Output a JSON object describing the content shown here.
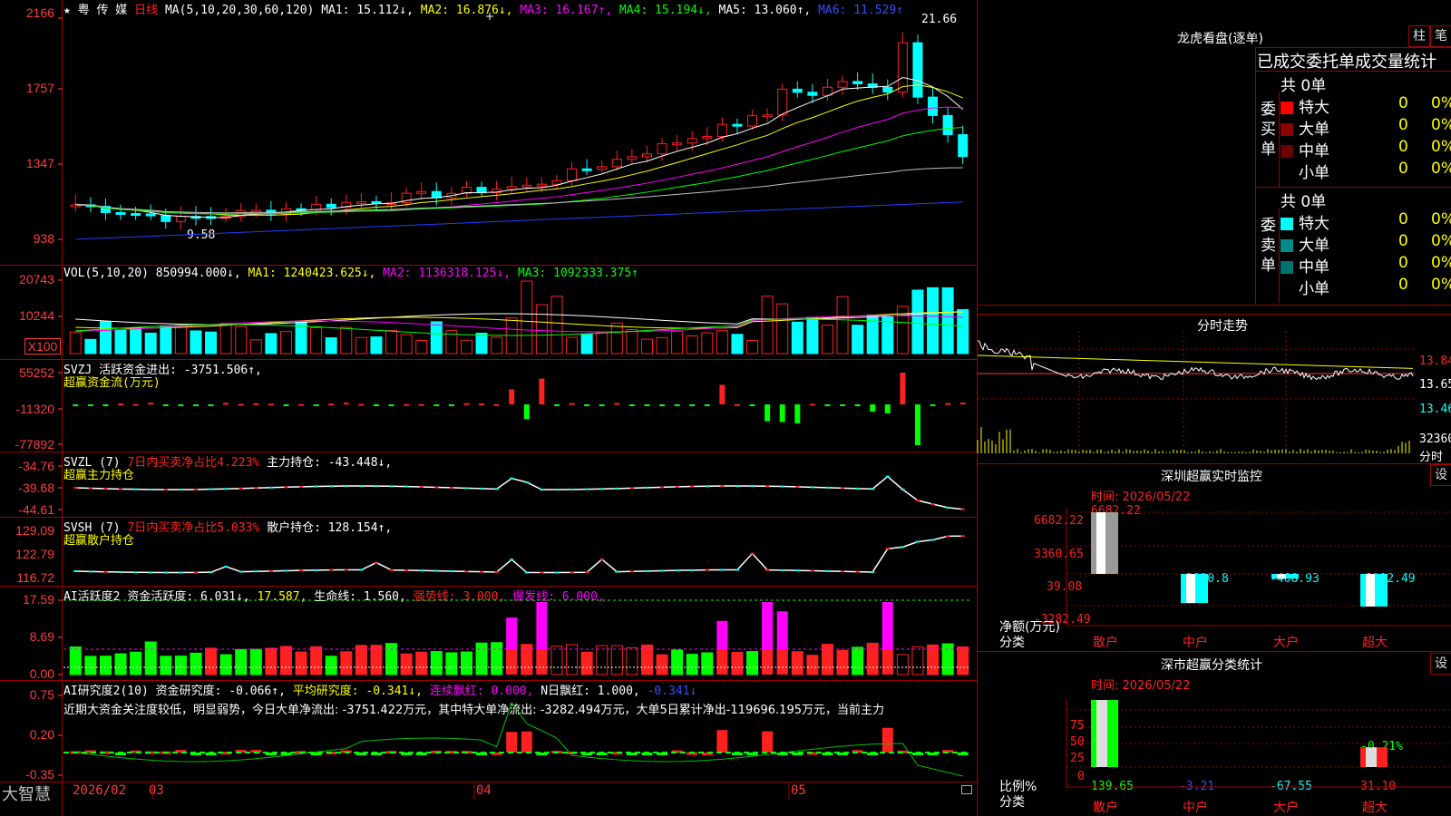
{
  "header": {
    "star": "★",
    "stock_name": "粤 传 媒",
    "period": "日线",
    "ma_params": "MA(5,10,20,30,60,120)",
    "ma1": "MA1: 15.112↓,",
    "ma2": "MA2: 16.876↓,",
    "ma3": "MA3: 16.167↑,",
    "ma4": "MA4: 15.194↓,",
    "ma5": "MA5: 13.060↑,",
    "ma6": "MA6: 11.529↑",
    "high_label": "21.66",
    "low_label": "9.58"
  },
  "price_axis": [
    "2166",
    "1757",
    "1347",
    "938"
  ],
  "vol": {
    "title": "VOL(5,10,20)",
    "value": "850994.000↓,",
    "ma1": "MA1: 1240423.625↓,",
    "ma2": "MA2: 1136318.125↓,",
    "ma3": "MA3: 1092333.375↑",
    "axis": [
      "20743",
      "10244"
    ],
    "unit": "X100"
  },
  "svzj": {
    "title": "SVZJ",
    "text": "活跃资金进出: -3751.506↑,",
    "subtitle": "超赢资金流(万元)",
    "axis": [
      "55252",
      "-11320",
      "-77892"
    ]
  },
  "svzl": {
    "title": "SVZL  (7)",
    "text1": "7日内买卖净占比4.223%",
    "text2": "主力持仓: -43.448↓,",
    "subtitle": "超赢主力持仓",
    "axis": [
      "-34.76",
      "-39.68",
      "-44.61"
    ]
  },
  "svsh": {
    "title": "SVSH  (7)",
    "text1": "7日内买卖净占比5.033%",
    "text2": "散户持仓: 128.154↑,",
    "subtitle": "超赢散户持仓",
    "axis": [
      "129.09",
      "122.79",
      "116.72"
    ]
  },
  "ai_active": {
    "title": "AI活跃度2",
    "text1": "资金活跃度: 6.031↓,",
    "text2": "17.587,",
    "text3": "生命线: 1.560,",
    "text4": "强势线: 3.000,",
    "text5": "爆发线: 6.000,",
    "axis": [
      "17.59",
      "8.69",
      "0.00"
    ]
  },
  "ai_research": {
    "title": "AI研究度2(10)",
    "text1": "资金研究度: -0.066↑,",
    "text2": "平均研究度: -0.341↓,",
    "text3": "连续飘红: 0.000,",
    "text4": "N日飘红: 1.000,",
    "text5": "-0.341↓",
    "comment": "近期大资金关注度较低，明显弱势，今日大单净流出: -3751.422万元，其中特大单净流出: -3282.494万元，大单5日累计净出-119696.195万元，当前主力",
    "axis": [
      "0.75",
      "0.20",
      "-0.35"
    ]
  },
  "date_axis": [
    "2026/02",
    "03",
    "04",
    "05"
  ],
  "brand": "大智慧",
  "lhb": {
    "title": "龙虎看盘(逐单)",
    "btn1": "柱",
    "btn2": "笔",
    "header": "已成交委托单成交量统计",
    "buy_label": "委买单",
    "sell_label": "委卖单",
    "buy_total": "共 0单",
    "sell_total": "共 0单",
    "buy_rows": [
      {
        "name": "特大",
        "count": "0",
        "pct": "0%",
        "color": "#ff0000"
      },
      {
        "name": "大单",
        "count": "0",
        "pct": "0%",
        "color": "#8b0000"
      },
      {
        "name": "中单",
        "count": "0",
        "pct": "0%",
        "color": "#6a0000"
      },
      {
        "name": "小单",
        "count": "0",
        "pct": "0%",
        "color": "#000000"
      }
    ],
    "sell_rows": [
      {
        "name": "特大",
        "count": "0",
        "pct": "0%",
        "color": "#00ffff"
      },
      {
        "name": "大单",
        "count": "0",
        "pct": "0%",
        "color": "#008b8b"
      },
      {
        "name": "中单",
        "count": "0",
        "pct": "0%",
        "color": "#007070"
      },
      {
        "name": "小单",
        "count": "0",
        "pct": "0%",
        "color": "#000000"
      }
    ]
  },
  "intraday": {
    "title": "分时走势",
    "axis": [
      "13.84",
      "13.65",
      "13.46"
    ],
    "vol_axis": [
      "32360",
      "分时"
    ]
  },
  "monitor": {
    "title": "深圳超赢实时监控",
    "btn": "设",
    "time": "时间: 2026/05/22",
    "axis": [
      "6682.22",
      "3360.65",
      "39.08",
      "-3282.49"
    ],
    "y_caption1": "净额(万元)",
    "y_caption2": "分类",
    "categories": [
      "散户",
      "中户",
      "大户",
      "超大"
    ],
    "values": [
      6682.22,
      -2930.8,
      -468.93,
      -3282.49
    ],
    "labels": [
      "6682.22",
      "-2930.8",
      "-468.93",
      "-3282.49"
    ]
  },
  "classify": {
    "title": "深市超赢分类统计",
    "btn": "设",
    "time": "时间: 2026/05/22",
    "axis": [
      "75",
      "50",
      "25",
      "0"
    ],
    "y_caption1": "比例%",
    "y_caption2": "分类",
    "categories": [
      "散户",
      "中户",
      "大户",
      "超大"
    ],
    "bar_labels": [
      "",
      "",
      "",
      "-0.21%"
    ],
    "values_bottom": [
      "139.65",
      "-3.21",
      "-67.55",
      "31.10"
    ]
  }
}
